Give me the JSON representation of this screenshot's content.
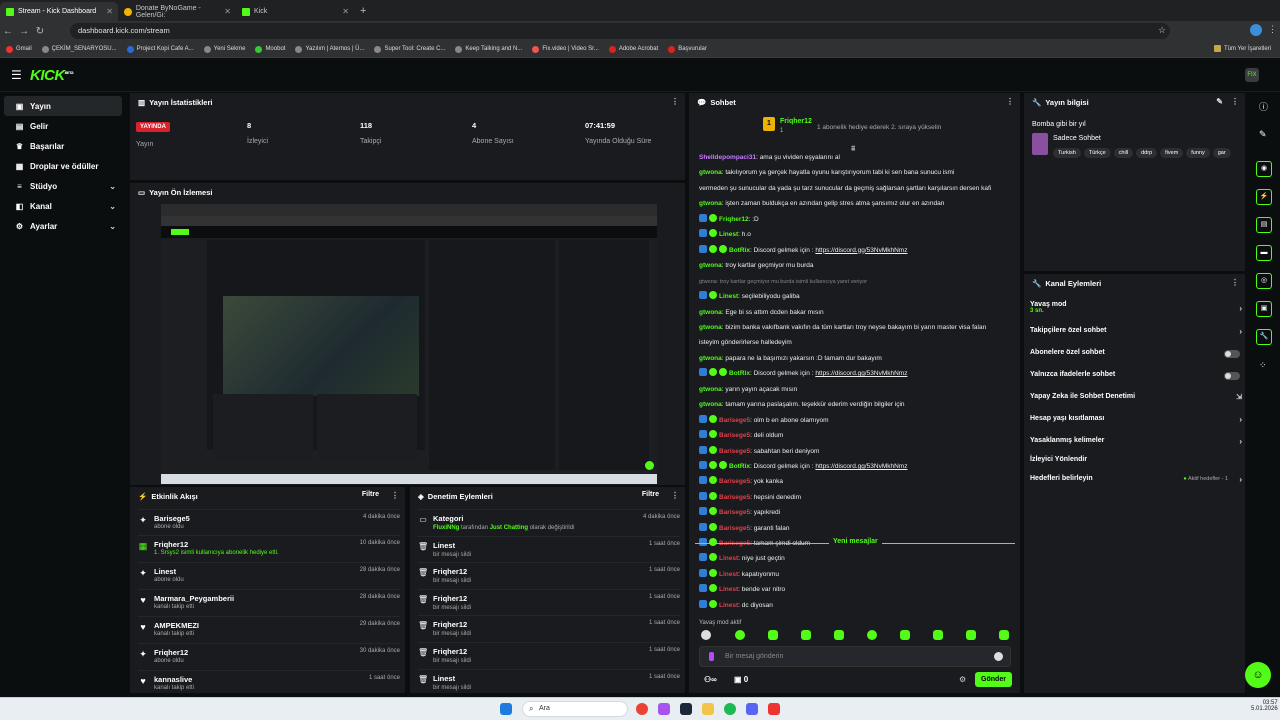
{
  "browser": {
    "tabs": [
      {
        "label": "Stream - Kick Dashboard",
        "favicon": "kick-icon"
      },
      {
        "label": "Donate ByNoGame - Gelen/Gi:",
        "favicon": "donate-icon"
      },
      {
        "label": "Kick",
        "favicon": "kick-icon"
      }
    ],
    "new_tab": "+",
    "url": "dashboard.kick.com/stream",
    "bookmarks": [
      "Gmail",
      "ÇEKİM_SENARYOSU...",
      "Project Kopi Cafe A...",
      "Yeni Sekme",
      "Moobot",
      "Yazılım | Aternos | Ü...",
      "Super Tool: Create C...",
      "Keep Talking and N...",
      "Fix.video | Video Sr...",
      "Adobe Acrobat",
      "Başvurular"
    ],
    "all_bookmarks": "Tüm Yer İşaretleri"
  },
  "header": {
    "logo": "KICK",
    "logo_sup": "BETA",
    "avatar": "FIX"
  },
  "sidebar": {
    "items": [
      {
        "label": "Yayın",
        "icon": "video-icon"
      },
      {
        "label": "Gelir",
        "icon": "wallet-icon"
      },
      {
        "label": "Başarılar",
        "icon": "trophy-icon"
      },
      {
        "label": "Droplar ve ödüller",
        "icon": "gift-icon"
      },
      {
        "label": "Stüdyo",
        "icon": "sliders-icon"
      },
      {
        "label": "Kanal",
        "icon": "channel-icon"
      },
      {
        "label": "Ayarlar",
        "icon": "gear-icon"
      }
    ]
  },
  "stats": {
    "title": "Yayın İstatistikleri",
    "live_badge": "YAYINDA",
    "cols": [
      {
        "value": "",
        "label": "Yayın"
      },
      {
        "value": "8",
        "label": "İzleyici"
      },
      {
        "value": "118",
        "label": "Takipçi"
      },
      {
        "value": "4",
        "label": "Abone Sayısı"
      },
      {
        "value": "07:41:59",
        "label": "Yayında Olduğu Süre"
      }
    ]
  },
  "preview": {
    "title": "Yayın Ön İzlemesi"
  },
  "events": {
    "title": "Etkinlik Akışı",
    "filter": "Filtre",
    "items": [
      {
        "name": "Barisege5",
        "sub": "abone oldu",
        "time": "4 dakika önce",
        "icon": "star-icon",
        "highlight": false
      },
      {
        "name": "Friqher12",
        "sub": "1. Srsys2 isimli kullanıcıya abonelik hediye etti.",
        "time": "10 dakika önce",
        "icon": "gift-icon",
        "highlight": true
      },
      {
        "name": "Linest",
        "sub": "abone oldu",
        "time": "28 dakika önce",
        "icon": "star-icon",
        "highlight": false
      },
      {
        "name": "Marmara_Peygamberii",
        "sub": "kanalı takip etti",
        "time": "28 dakika önce",
        "icon": "heart-icon",
        "highlight": false
      },
      {
        "name": "AMPEKMEZI",
        "sub": "kanalı takip etti",
        "time": "29 dakika önce",
        "icon": "heart-icon",
        "highlight": false
      },
      {
        "name": "Friqher12",
        "sub": "abone oldu",
        "time": "30 dakika önce",
        "icon": "star-icon",
        "highlight": false
      },
      {
        "name": "kannaslive",
        "sub": "kanalı takip etti",
        "time": "1 saat önce",
        "icon": "heart-icon",
        "highlight": false
      }
    ]
  },
  "moderation": {
    "title": "Denetim Eylemleri",
    "filter": "Filtre",
    "items": [
      {
        "name": "Kategori",
        "sub_user": "FluxiNNg",
        "sub_mid": " tarafından ",
        "sub_cat": "Just Chatting",
        "sub_end": " olarak değiştirildi",
        "time": "4 dakika önce",
        "icon": "folder-icon"
      },
      {
        "name": "Linest",
        "sub": "bir mesajı sildi",
        "time": "1 saat önce",
        "icon": "trash-icon"
      },
      {
        "name": "Friqher12",
        "sub": "bir mesajı sildi",
        "time": "1 saat önce",
        "icon": "trash-icon"
      },
      {
        "name": "Friqher12",
        "sub": "bir mesajı sildi",
        "time": "1 saat önce",
        "icon": "trash-icon"
      },
      {
        "name": "Friqher12",
        "sub": "bir mesajı sildi",
        "time": "1 saat önce",
        "icon": "trash-icon"
      },
      {
        "name": "Friqher12",
        "sub": "bir mesajı sildi",
        "time": "1 saat önce",
        "icon": "trash-icon"
      },
      {
        "name": "Linest",
        "sub": "bir mesajı sildi",
        "time": "1 saat önce",
        "icon": "trash-icon"
      }
    ]
  },
  "chat": {
    "title": "Sohbet",
    "gifter_name": "Friqher12",
    "gifter_count": "1",
    "gifter_text": "1 abonelik hediye ederek 2. sıraya yükselin",
    "messages": [
      {
        "user": "Shelldepompaci31",
        "text": ": ama şu vividen eşyalarını al",
        "color": "#c97bff",
        "badges": 0
      },
      {
        "user": "gtwona",
        "text": ": takılıyorum ya gerçek hayatla oyunu karıştırıyorum tabi ki sen bana sunucu ismi",
        "color": "#53fc18",
        "badges": 0
      },
      {
        "user": "",
        "text": "vermeden şu sunucular da yada şu tarz sunucular da geçmiş sağlarsan şartları karşılarsın dersen kafi",
        "color": "#53fc18",
        "badges": 0
      },
      {
        "user": "gtwona",
        "text": ": işten zaman buldukça en azından gelip stres atma şansımız olur en azından",
        "color": "#53fc18",
        "badges": 0
      },
      {
        "user": "Friqher12",
        "text": ": :D",
        "color": "#53fc18",
        "badges": 2
      },
      {
        "user": "Linest",
        "text": ": h.o",
        "color": "#53fc18",
        "badges": 2
      },
      {
        "user": "BotRix",
        "text": ": Discord gelmek için : ",
        "link": "https://discord.gg/53NvMkhNmz",
        "color": "#53fc18",
        "badges": 3
      },
      {
        "user": "gtwona",
        "text": ": troy kartlar geçmiyor mu burda",
        "color": "#53fc18",
        "badges": 0
      },
      {
        "user": "",
        "text": "gtwona: troy kartlar geçmiyor mu burda isimli kullanıcıya yanıt veriyor",
        "color": "#888",
        "badges": 0,
        "reply": true
      },
      {
        "user": "Linest",
        "text": ": seçilebiliyodu galiba",
        "color": "#53fc18",
        "badges": 2
      },
      {
        "user": "gtwona",
        "text": ": Ege bi ss attım dcden bakar mısın",
        "color": "#53fc18",
        "badges": 0
      },
      {
        "user": "gtwona",
        "text": ": bizim banka vakıfbank vakıfın da tüm kartları troy neyse bakayım bi yarın master visa falan",
        "color": "#53fc18",
        "badges": 0
      },
      {
        "user": "",
        "text": "isteyim gönderirlerse halledeyim",
        "color": "#53fc18",
        "badges": 0
      },
      {
        "user": "gtwona",
        "text": ": papara ne la başımızı yakarsın :D tamam dur bakayım",
        "color": "#53fc18",
        "badges": 0
      },
      {
        "user": "BotRix",
        "text": ": Discord gelmek için : ",
        "link": "https://discord.gg/53NvMkhNmz",
        "color": "#53fc18",
        "badges": 3
      },
      {
        "user": "gtwona",
        "text": ": yarın yayın açacak mısın",
        "color": "#53fc18",
        "badges": 0
      },
      {
        "user": "gtwona",
        "text": ": tamam yarına paslaşalım. teşekkür ederim verdiğin bilgiler için",
        "color": "#53fc18",
        "badges": 0
      },
      {
        "user": "Barisege5",
        "text": ": olm b en abone olamıyom",
        "color": "#e0414a",
        "badges": 2
      },
      {
        "user": "Barisege5",
        "text": ": deli oldum",
        "color": "#e0414a",
        "badges": 2
      },
      {
        "user": "Barisege5",
        "text": ": sabahtan beri deniyom",
        "color": "#e0414a",
        "badges": 2
      },
      {
        "user": "BotRix",
        "text": ": Discord gelmek için : ",
        "link": "https://discord.gg/53NvMkhNmz",
        "color": "#53fc18",
        "badges": 3
      },
      {
        "user": "Barisege5",
        "text": ": yok kanka",
        "color": "#e0414a",
        "badges": 2
      },
      {
        "user": "Barisege5",
        "text": ": hepsini denedim",
        "color": "#e0414a",
        "badges": 2
      },
      {
        "user": "Barisege5",
        "text": ": yapıkredi",
        "color": "#e0414a",
        "badges": 2
      },
      {
        "user": "Barisege5",
        "text": ": garanti falan",
        "color": "#e0414a",
        "badges": 2
      },
      {
        "user": "Barisege5",
        "text": ": tamam şimdi oldum",
        "color": "#e0414a",
        "badges": 2
      }
    ],
    "new_messages_label": "Yeni mesajlar",
    "new_messages": [
      {
        "user": "Linest",
        "text": ": niye just geçtin",
        "color": "#e0414a"
      },
      {
        "user": "Linest",
        "text": ": kapatıyonmu",
        "color": "#e0414a"
      },
      {
        "user": "Linest",
        "text": ": bende var nitro",
        "color": "#e0414a"
      },
      {
        "user": "Linest",
        "text": ": dc diyosan",
        "color": "#e0414a"
      }
    ],
    "slow_mode": "Yavaş mod aktif",
    "input_placeholder": "Bir mesaj gönderin",
    "infinity": "∞",
    "count": "0",
    "send": "Gönder"
  },
  "stream_info": {
    "title": "Yayın bilgisi",
    "stream_title": "Bomba gibi bir yıl",
    "category": "Sadece Sohbet",
    "tags": [
      "Turkish",
      "Türkçe",
      "chill",
      "ddrp",
      "fivem",
      "funny",
      "gar"
    ]
  },
  "channel_actions": {
    "title": "Kanal Eylemleri",
    "items": [
      {
        "label": "Yavaş mod",
        "sub": "3 sn.",
        "control": "chevron"
      },
      {
        "label": "Takipçilere özel sohbet",
        "control": "chevron"
      },
      {
        "label": "Abonelere özel sohbet",
        "control": "toggle"
      },
      {
        "label": "Yalnızca ifadelerle sohbet",
        "control": "toggle"
      },
      {
        "label": "Yapay Zeka ile Sohbet Denetimi",
        "control": "external"
      },
      {
        "label": "Hesap yaşı kısıtlaması",
        "control": "chevron"
      },
      {
        "label": "Yasaklanmış kelimeler",
        "control": "chevron"
      },
      {
        "label": "İzleyici Yönlendir",
        "control": "none"
      },
      {
        "label": "Hedefleri belirleyin",
        "control": "chevron",
        "status": "Aktif hedefler - 1"
      }
    ]
  },
  "taskbar": {
    "search": "Ara",
    "time": "03:57",
    "date": "5.01.2026"
  }
}
